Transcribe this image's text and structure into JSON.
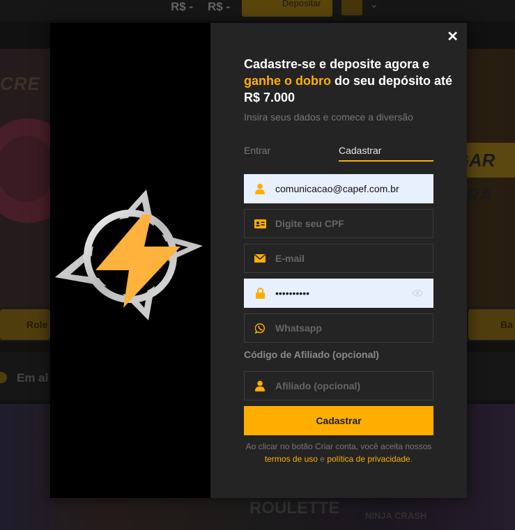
{
  "background": {
    "balance_1": "R$ -",
    "balance_2": "R$ -",
    "deposit_label": "Depositar",
    "banner_text": "CRE",
    "promo_text": "JOGAR AGORA",
    "pill_left": "Role",
    "pill_right": "Ba",
    "section_title": "Em al",
    "tile_1": "ROULETTE",
    "tile_2": "NINJA CRASH"
  },
  "modal": {
    "close_label": "✕",
    "title_part1": "Cadastre-se e deposite agora e ",
    "title_highlight": "ganhe o dobro",
    "title_part2": " do seu depósito até R$ 7.000",
    "subtitle": "Insira seus dados e comece a diversão",
    "tabs": {
      "login": "Entrar",
      "register": "Cadastrar"
    },
    "fields": {
      "username": {
        "value": "comunicacao@capef.com.br",
        "icon": "user-icon"
      },
      "cpf": {
        "placeholder": "Digite seu CPF",
        "icon": "id-card-icon"
      },
      "email": {
        "placeholder": "E-mail",
        "icon": "envelope-icon"
      },
      "password": {
        "value": "••••••••••",
        "icon": "lock-icon"
      },
      "whatsapp": {
        "placeholder": "Whatsapp",
        "icon": "whatsapp-icon"
      },
      "affiliate": {
        "placeholder": "Afiliado (opcional)",
        "icon": "user-icon"
      }
    },
    "affiliate_label": "Código de Afiliado (opcional)",
    "submit_label": "Cadastrar",
    "terms": {
      "prefix": "Ao clicar no botão Criar conta, você aceita nossos",
      "terms_link": "termos de uso",
      "and": " e ",
      "privacy_link": "política de privacidade",
      "suffix": "."
    },
    "accent_color": "#ffae00"
  }
}
